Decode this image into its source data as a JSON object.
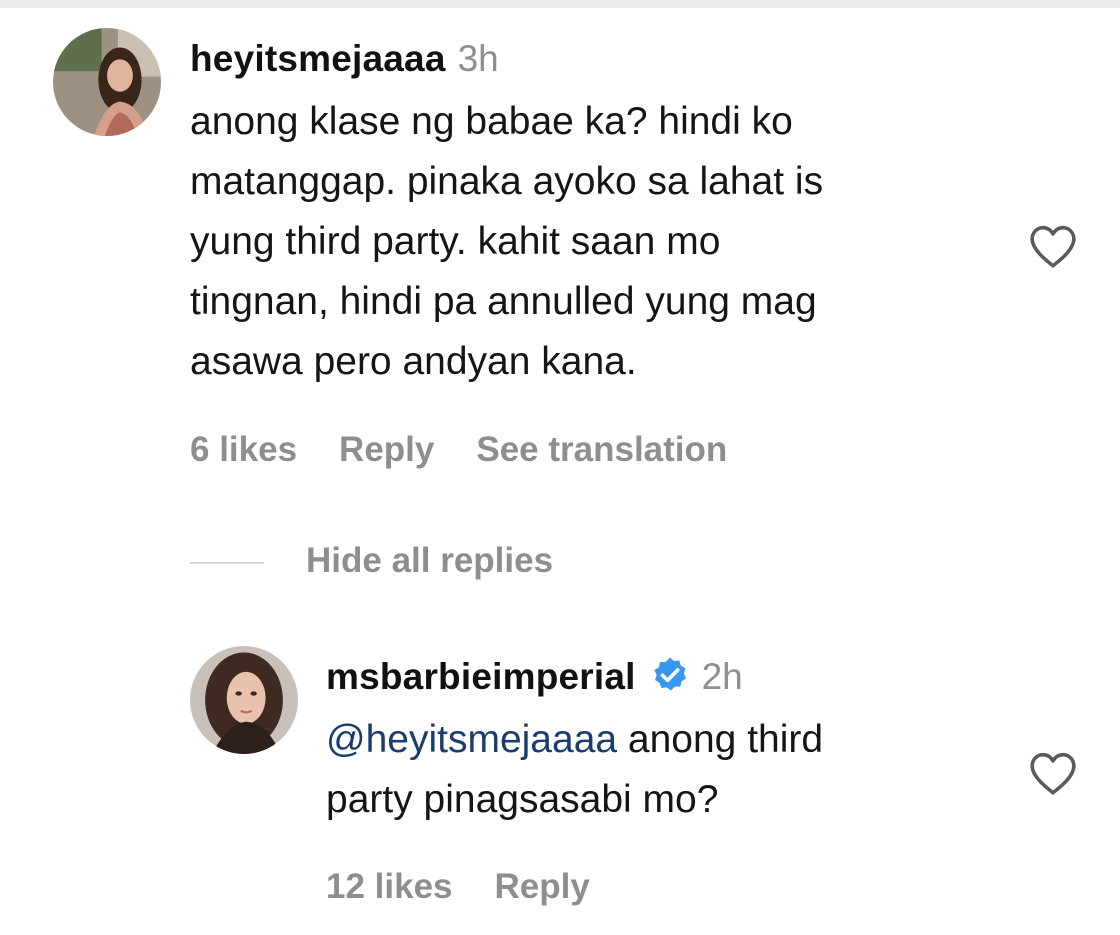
{
  "comment": {
    "username": "heyitsmejaaaa",
    "time": "3h",
    "lines": [
      "anong klase ng babae ka? hindi ko",
      "matanggap. pinaka ayoko sa lahat is",
      "yung third party. kahit saan mo",
      "tingnan, hindi pa annulled yung mag",
      "asawa pero andyan kana."
    ],
    "likes": "6 likes",
    "reply_label": "Reply",
    "translate_label": "See translation"
  },
  "replies_toggle": "Hide all replies",
  "reply": {
    "username": "msbarbieimperial",
    "time": "2h",
    "mention": "@heyitsmejaaaa",
    "line1_rest": " anong third",
    "line2": "party pinagsasabi mo?",
    "likes": "12 likes",
    "reply_label": "Reply"
  },
  "colors": {
    "secondary_text": "#8e8e8e",
    "mention": "#1b3d6e",
    "verified_badge": "#3897f0"
  },
  "icons": [
    "heart-icon",
    "verified-badge-icon",
    "avatar"
  ]
}
